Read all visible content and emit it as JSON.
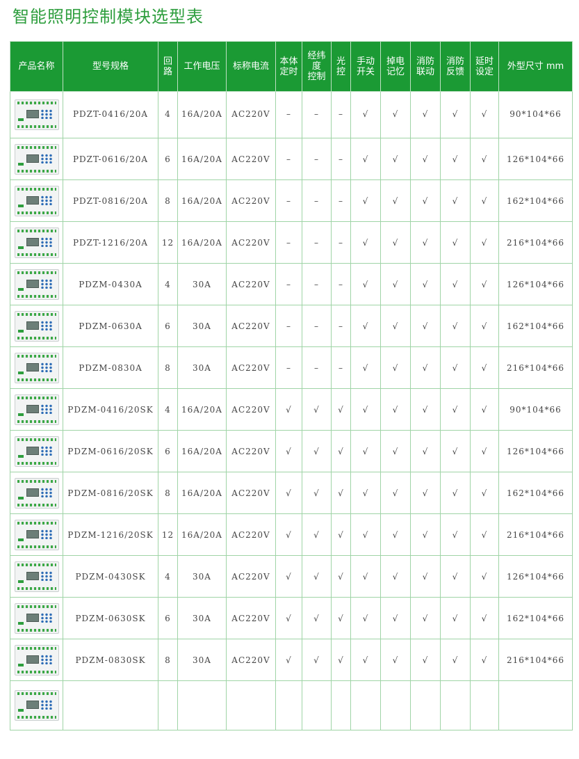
{
  "title": "智能照明控制模块选型表",
  "headers": {
    "name": "产品名称",
    "model": "型号规格",
    "circuits": [
      "回",
      "路"
    ],
    "work_voltage": "工作电压",
    "rated_current": "标称电流",
    "local_timer": [
      "本体",
      "定时"
    ],
    "latlong": [
      "经纬",
      "度",
      "控制"
    ],
    "light": [
      "光",
      "控"
    ],
    "manual": [
      "手动",
      "开关"
    ],
    "memory": [
      "掉电",
      "记忆"
    ],
    "fire_link": [
      "消防",
      "联动"
    ],
    "fire_feedback": [
      "消防",
      "反馈"
    ],
    "delay": [
      "延时",
      "设定"
    ],
    "size": "外型尺寸 mm"
  },
  "rows": [
    {
      "model": "PDZT-0416/20A",
      "circuits": "4",
      "work": "16A/20A",
      "current": "AC220V",
      "timer": "–",
      "latlong": "–",
      "light": "–",
      "manual": "√",
      "memory": "√",
      "fire_link": "√",
      "fire_fb": "√",
      "delay": "√",
      "size": "90*104*66"
    },
    {
      "model": "PDZT-0616/20A",
      "circuits": "6",
      "work": "16A/20A",
      "current": "AC220V",
      "timer": "–",
      "latlong": "–",
      "light": "–",
      "manual": "√",
      "memory": "√",
      "fire_link": "√",
      "fire_fb": "√",
      "delay": "√",
      "size": "126*104*66"
    },
    {
      "model": "PDZT-0816/20A",
      "circuits": "8",
      "work": "16A/20A",
      "current": "AC220V",
      "timer": "–",
      "latlong": "–",
      "light": "–",
      "manual": "√",
      "memory": "√",
      "fire_link": "√",
      "fire_fb": "√",
      "delay": "√",
      "size": "162*104*66"
    },
    {
      "model": "PDZT-1216/20A",
      "circuits": "12",
      "work": "16A/20A",
      "current": "AC220V",
      "timer": "–",
      "latlong": "–",
      "light": "–",
      "manual": "√",
      "memory": "√",
      "fire_link": "√",
      "fire_fb": "√",
      "delay": "√",
      "size": "216*104*66"
    },
    {
      "model": "PDZM-0430A",
      "circuits": "4",
      "work": "30A",
      "current": "AC220V",
      "timer": "–",
      "latlong": "–",
      "light": "–",
      "manual": "√",
      "memory": "√",
      "fire_link": "√",
      "fire_fb": "√",
      "delay": "√",
      "size": "126*104*66"
    },
    {
      "model": "PDZM-0630A",
      "circuits": "6",
      "work": "30A",
      "current": "AC220V",
      "timer": "–",
      "latlong": "–",
      "light": "–",
      "manual": "√",
      "memory": "√",
      "fire_link": "√",
      "fire_fb": "√",
      "delay": "√",
      "size": "162*104*66"
    },
    {
      "model": "PDZM-0830A",
      "circuits": "8",
      "work": "30A",
      "current": "AC220V",
      "timer": "–",
      "latlong": "–",
      "light": "–",
      "manual": "√",
      "memory": "√",
      "fire_link": "√",
      "fire_fb": "√",
      "delay": "√",
      "size": "216*104*66"
    },
    {
      "model": "PDZM-0416/20SK",
      "circuits": "4",
      "work": "16A/20A",
      "current": "AC220V",
      "timer": "√",
      "latlong": "√",
      "light": "√",
      "manual": "√",
      "memory": "√",
      "fire_link": "√",
      "fire_fb": "√",
      "delay": "√",
      "size": "90*104*66"
    },
    {
      "model": "PDZM-0616/20SK",
      "circuits": "6",
      "work": "16A/20A",
      "current": "AC220V",
      "timer": "√",
      "latlong": "√",
      "light": "√",
      "manual": "√",
      "memory": "√",
      "fire_link": "√",
      "fire_fb": "√",
      "delay": "√",
      "size": "126*104*66"
    },
    {
      "model": "PDZM-0816/20SK",
      "circuits": "8",
      "work": "16A/20A",
      "current": "AC220V",
      "timer": "√",
      "latlong": "√",
      "light": "√",
      "manual": "√",
      "memory": "√",
      "fire_link": "√",
      "fire_fb": "√",
      "delay": "√",
      "size": "162*104*66"
    },
    {
      "model": "PDZM-1216/20SK",
      "circuits": "12",
      "work": "16A/20A",
      "current": "AC220V",
      "timer": "√",
      "latlong": "√",
      "light": "√",
      "manual": "√",
      "memory": "√",
      "fire_link": "√",
      "fire_fb": "√",
      "delay": "√",
      "size": "216*104*66"
    },
    {
      "model": "PDZM-0430SK",
      "circuits": "4",
      "work": "30A",
      "current": "AC220V",
      "timer": "√",
      "latlong": "√",
      "light": "√",
      "manual": "√",
      "memory": "√",
      "fire_link": "√",
      "fire_fb": "√",
      "delay": "√",
      "size": "126*104*66"
    },
    {
      "model": "PDZM-0630SK",
      "circuits": "6",
      "work": "30A",
      "current": "AC220V",
      "timer": "√",
      "latlong": "√",
      "light": "√",
      "manual": "√",
      "memory": "√",
      "fire_link": "√",
      "fire_fb": "√",
      "delay": "√",
      "size": "162*104*66"
    },
    {
      "model": "PDZM-0830SK",
      "circuits": "8",
      "work": "30A",
      "current": "AC220V",
      "timer": "√",
      "latlong": "√",
      "light": "√",
      "manual": "√",
      "memory": "√",
      "fire_link": "√",
      "fire_fb": "√",
      "delay": "√",
      "size": "216*104*66"
    },
    {
      "model": "",
      "circuits": "",
      "work": "",
      "current": "",
      "timer": "",
      "latlong": "",
      "light": "",
      "manual": "",
      "memory": "",
      "fire_link": "",
      "fire_fb": "",
      "delay": "",
      "size": ""
    }
  ],
  "colors": {
    "accent": "#1b9a34",
    "title": "#2e9e3e",
    "grid": "#9fd4a6"
  }
}
